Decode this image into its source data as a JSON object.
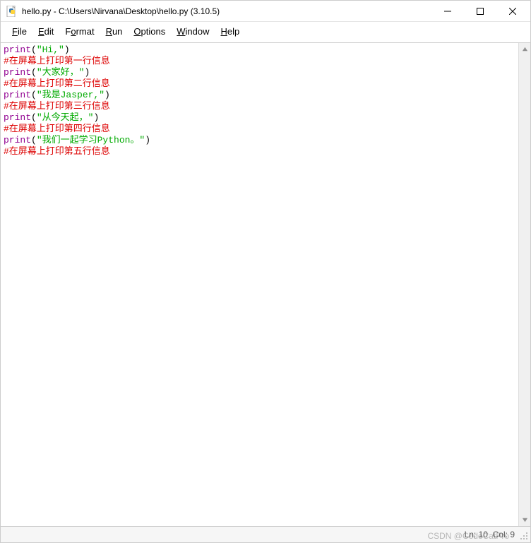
{
  "window": {
    "title": "hello.py - C:\\Users\\Nirvana\\Desktop\\hello.py (3.10.5)"
  },
  "menu": {
    "file": {
      "hotkey": "F",
      "rest": "ile"
    },
    "edit": {
      "hotkey": "E",
      "rest": "dit"
    },
    "format": {
      "hotkey": "F",
      "rest": "ormat",
      "pre": "F",
      "hot": "o",
      "post": "rmat"
    },
    "run": {
      "hotkey": "R",
      "rest": "un"
    },
    "options": {
      "hotkey": "O",
      "rest": "ptions"
    },
    "window": {
      "hotkey": "W",
      "rest": "indow"
    },
    "help": {
      "hotkey": "H",
      "rest": "elp"
    }
  },
  "code": {
    "lines": [
      {
        "type": "print",
        "func": "print",
        "open": "(",
        "str": "\"Hi,\"",
        "close": ")"
      },
      {
        "type": "comment",
        "text": "#在屏幕上打印第一行信息"
      },
      {
        "type": "print",
        "func": "print",
        "open": "(",
        "str": "\"大家好，\"",
        "close": ")"
      },
      {
        "type": "comment",
        "text": "#在屏幕上打印第二行信息"
      },
      {
        "type": "print",
        "func": "print",
        "open": "(",
        "str": "\"我是Jasper,\"",
        "close": ")"
      },
      {
        "type": "comment",
        "text": "#在屏幕上打印第三行信息"
      },
      {
        "type": "print",
        "func": "print",
        "open": "(",
        "str": "\"从今天起，\"",
        "close": ")"
      },
      {
        "type": "comment",
        "text": "#在屏幕上打印第四行信息"
      },
      {
        "type": "print",
        "func": "print",
        "open": "(",
        "str": "\"我们一起学习Python。\"",
        "close": ")"
      },
      {
        "type": "comment",
        "text": "#在屏幕上打印第五行信息"
      }
    ]
  },
  "status": {
    "ln_label": "Ln:",
    "ln": "10",
    "col_label": "Col:",
    "col": "9"
  },
  "watermark": "CSDN @CodeCatPro"
}
